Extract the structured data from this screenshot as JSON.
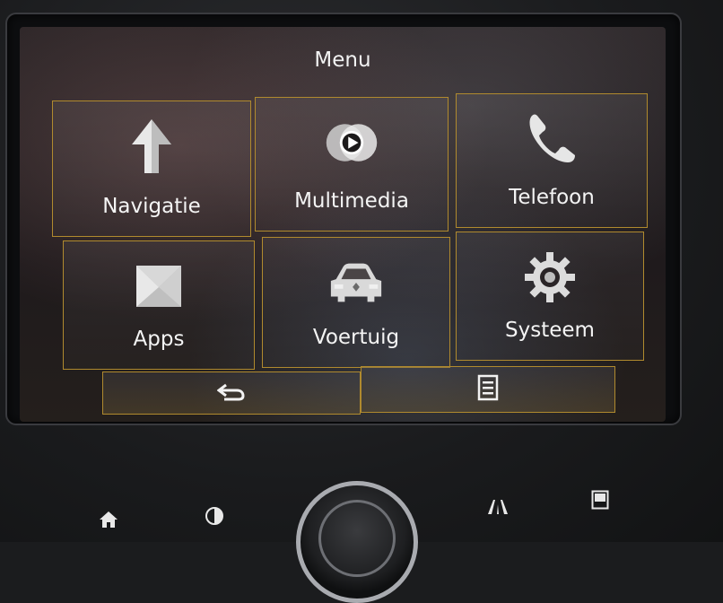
{
  "screen": {
    "title": "Menu"
  },
  "tiles": [
    {
      "label": "Navigatie",
      "icon": "navigation-arrow-icon"
    },
    {
      "label": "Multimedia",
      "icon": "play-media-icon"
    },
    {
      "label": "Telefoon",
      "icon": "phone-handset-icon"
    },
    {
      "label": "Apps",
      "icon": "apps-envelope-icon"
    },
    {
      "label": "Voertuig",
      "icon": "car-front-icon"
    },
    {
      "label": "Systeem",
      "icon": "gear-icon"
    }
  ],
  "bottom_bar": {
    "back_icon": "back-arrow-icon",
    "list_icon": "list-menu-icon"
  },
  "hardware_buttons": {
    "home_icon": "home-icon",
    "brightness_icon": "brightness-icon",
    "driving_assist_icon": "lane-assist-icon",
    "display_icon": "display-icon"
  },
  "colors": {
    "accent": "#b08a2e",
    "text": "#f4f4f4"
  }
}
